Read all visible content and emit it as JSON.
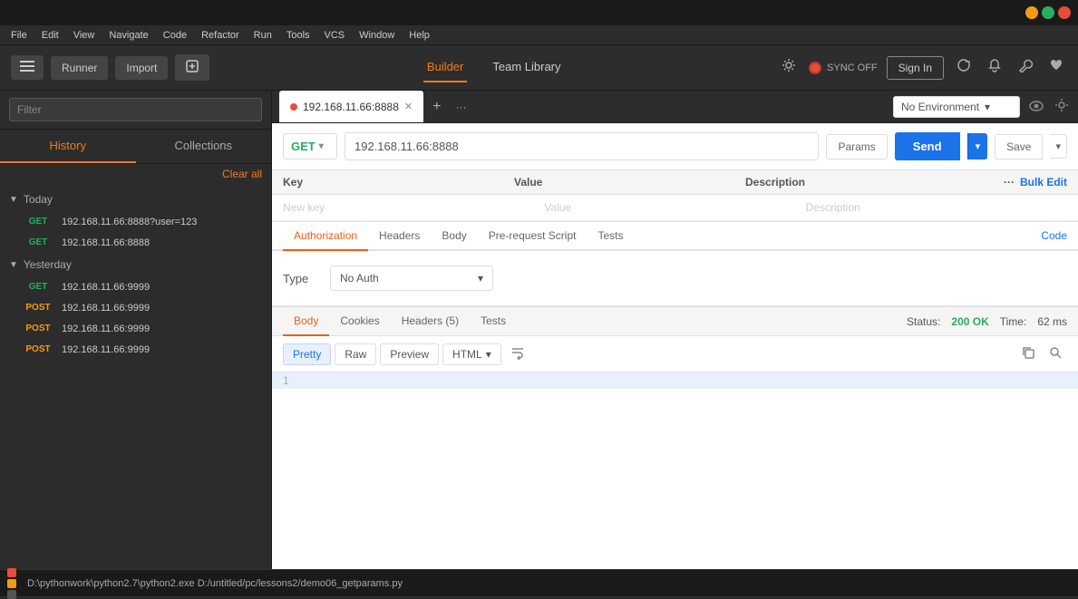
{
  "titlebar": {
    "title": "",
    "controls": [
      "min",
      "max",
      "close"
    ]
  },
  "menubar": {
    "items": [
      "File",
      "Edit",
      "View",
      "Navigate",
      "Code",
      "Refactor",
      "Run",
      "Tools",
      "VCS",
      "Window",
      "Help"
    ]
  },
  "toolbar": {
    "sidebar_toggle_label": "☰",
    "runner_label": "Runner",
    "import_label": "Import",
    "new_tab_icon": "+",
    "builder_tab": "Builder",
    "team_library_tab": "Team Library",
    "sync_text": "SYNC OFF",
    "sign_in_label": "Sign In"
  },
  "env_selector": {
    "label": "No Environment",
    "chevron": "▾"
  },
  "sidebar": {
    "filter_placeholder": "Filter",
    "history_tab": "History",
    "collections_tab": "Collections",
    "clear_all": "Clear all",
    "today_label": "Today",
    "yesterday_label": "Yesterday",
    "history_items": [
      {
        "method": "GET",
        "url": "192.168.11.66:8888?user=123"
      },
      {
        "method": "GET",
        "url": "192.168.11.66:8888"
      }
    ],
    "yesterday_items": [
      {
        "method": "GET",
        "url": "192.168.11.66:9999"
      },
      {
        "method": "POST",
        "url": "192.168.11.66:9999"
      },
      {
        "method": "POST",
        "url": "192.168.11.66:9999"
      },
      {
        "method": "POST",
        "url": "192.168.11.66:9999"
      }
    ]
  },
  "request_tab": {
    "label": "192.168.11.66:8888",
    "dot_color": "#e74c3c"
  },
  "url_bar": {
    "method": "GET",
    "url": "192.168.11.66:8888",
    "params_label": "Params",
    "send_label": "Send",
    "save_label": "Save"
  },
  "params_table": {
    "headers": {
      "key": "Key",
      "value": "Value",
      "description": "Description",
      "bulk_edit": "Bulk Edit"
    },
    "new_key_placeholder": "New key",
    "value_placeholder": "Value",
    "description_placeholder": "Description"
  },
  "request_subtabs": {
    "tabs": [
      "Authorization",
      "Headers",
      "Body",
      "Pre-request Script",
      "Tests"
    ],
    "active": "Authorization",
    "code_link": "Code"
  },
  "auth_section": {
    "type_label": "Type",
    "no_auth_label": "No Auth",
    "chevron": "▾"
  },
  "response_tabs": {
    "tabs": [
      "Body",
      "Cookies",
      "Headers (5)",
      "Tests"
    ],
    "active": "Body",
    "status_label": "Status:",
    "status_value": "200 OK",
    "time_label": "Time:",
    "time_value": "62 ms"
  },
  "response_toolbar": {
    "pretty_label": "Pretty",
    "raw_label": "Raw",
    "preview_label": "Preview",
    "format_label": "HTML",
    "chevron": "▾"
  },
  "response_body": {
    "lines": [
      {
        "number": "1",
        "content": ""
      }
    ]
  },
  "bottom_bar": {
    "path": "D:\\pythonwork\\python2.7\\python2.exe D:/untitled/pc/lessons2/demo06_getparams.py"
  },
  "icons": {
    "settings": "⚙",
    "sync_dot": "●",
    "bell": "🔔",
    "wrench": "🔧",
    "heart": "♥",
    "eye": "👁",
    "copy": "⎘",
    "search": "🔍",
    "refresh": "↺",
    "more": "···",
    "chevron_down": "▾",
    "chevron_right": "▶",
    "star": "★",
    "new_tab": "⊞",
    "wrap": "⟲"
  }
}
